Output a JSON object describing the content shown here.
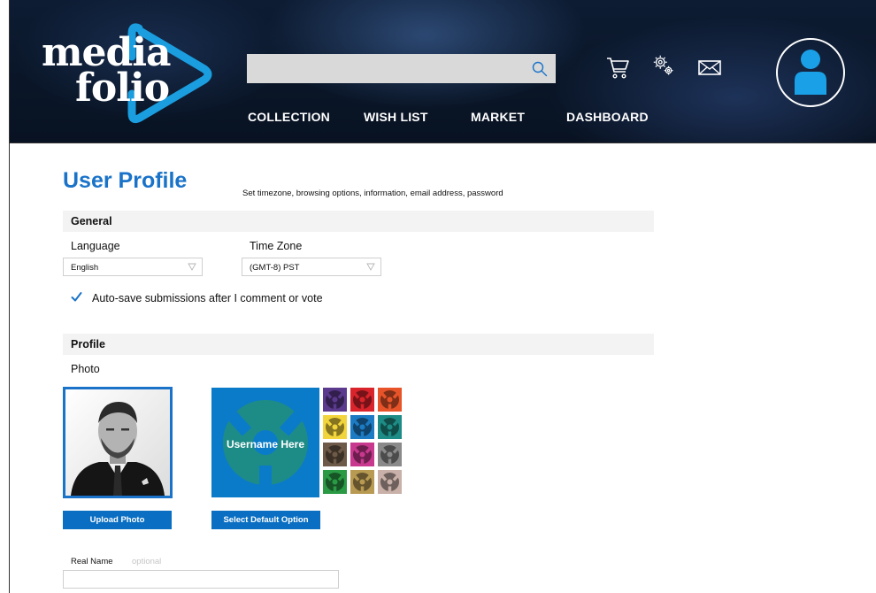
{
  "brand": {
    "line1": "media",
    "line2": "folio",
    "accent": "#1a9ee0"
  },
  "header": {
    "search": {
      "placeholder": "",
      "value": ""
    },
    "icons": [
      "search-icon",
      "cart-icon",
      "gear-icon",
      "mail-icon",
      "user-avatar-icon"
    ],
    "nav": [
      "COLLECTION",
      "WISH LIST",
      "MARKET",
      "DASHBOARD"
    ]
  },
  "page": {
    "title": "User Profile",
    "subtitle": "Set timezone, browsing options, information, email address, password"
  },
  "general": {
    "heading": "General",
    "language_label": "Language",
    "language_value": "English",
    "timezone_label": "Time Zone",
    "timezone_value": "(GMT-8) PST",
    "autosave_label": "Auto-save submissions after I comment or vote",
    "autosave_checked": true
  },
  "profile": {
    "heading": "Profile",
    "photo_label": "Photo",
    "default_username": "Username Here",
    "upload_button": "Upload Photo",
    "default_button": "Select Default Option",
    "swatch_colors": [
      "#5b3a8e",
      "#d9242c",
      "#e8542a",
      "#f2d53c",
      "#1d7bc4",
      "#1e8c86",
      "#6e5a48",
      "#c8388e",
      "#8a8a8a",
      "#2a9a45",
      "#b89a52",
      "#c9b0a8"
    ],
    "real_name_label": "Real Name",
    "real_name_hint": "optional",
    "real_name_value": ""
  },
  "colors": {
    "primary": "#1a73c8",
    "button": "#0a6fc2",
    "default_bg": "#0a7bc9",
    "default_icon": "#1e8c86"
  }
}
